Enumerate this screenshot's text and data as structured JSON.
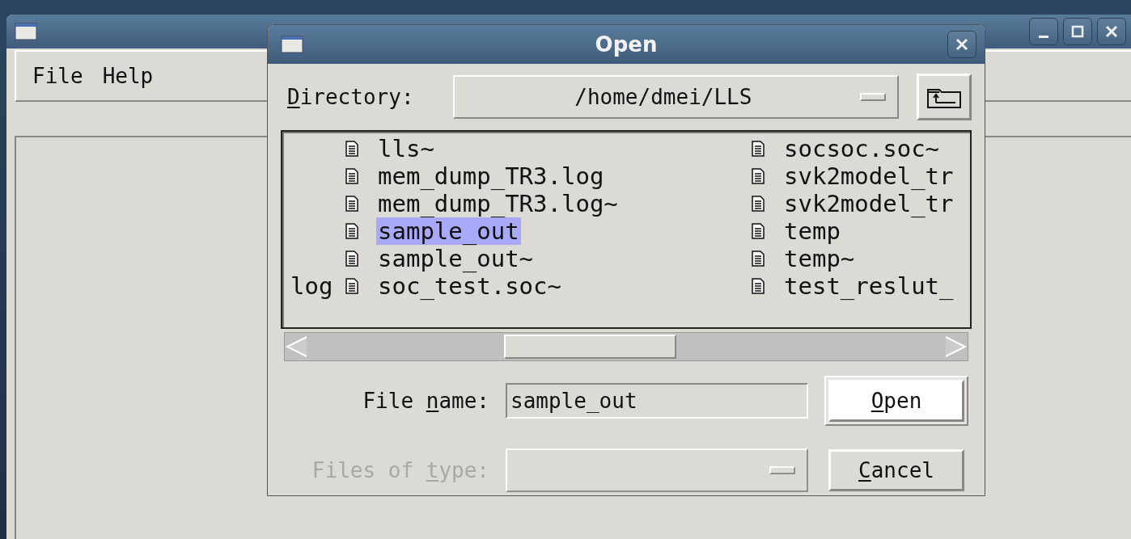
{
  "window": {
    "menu": [
      "File",
      "Help"
    ]
  },
  "dialog": {
    "title": "Open",
    "directory": {
      "label": {
        "key": "D",
        "after": "irectory:"
      },
      "value": "/home/dmei/LLS"
    },
    "files": {
      "columns": [
        [
          {
            "name": "lls~",
            "selected": false
          },
          {
            "name": "mem_dump_TR3.log",
            "selected": false
          },
          {
            "name": "mem_dump_TR3.log~",
            "selected": false
          },
          {
            "name": "sample_out",
            "selected": true
          },
          {
            "name": "sample_out~",
            "selected": false
          },
          {
            "name": "soc_test.soc~",
            "selected": false,
            "left_tail": "log"
          }
        ],
        [
          {
            "name": "socsoc.soc~",
            "selected": false
          },
          {
            "name": "svk2model_tr",
            "selected": false
          },
          {
            "name": "svk2model_tr",
            "selected": false
          },
          {
            "name": "temp",
            "selected": false
          },
          {
            "name": "temp~",
            "selected": false
          },
          {
            "name": "test_reslut_",
            "selected": false
          }
        ]
      ]
    },
    "file_name": {
      "label": {
        "before": "File ",
        "key": "n",
        "after": "ame:"
      },
      "value": "sample_out"
    },
    "file_type": {
      "label": {
        "before": "Files of ",
        "key": "t",
        "after": "ype:"
      },
      "disabled": true
    },
    "buttons": [
      {
        "label": {
          "key": "O",
          "after": "pen"
        },
        "default": true
      },
      {
        "label": {
          "key": "C",
          "after": "ancel"
        },
        "default": false
      }
    ]
  }
}
